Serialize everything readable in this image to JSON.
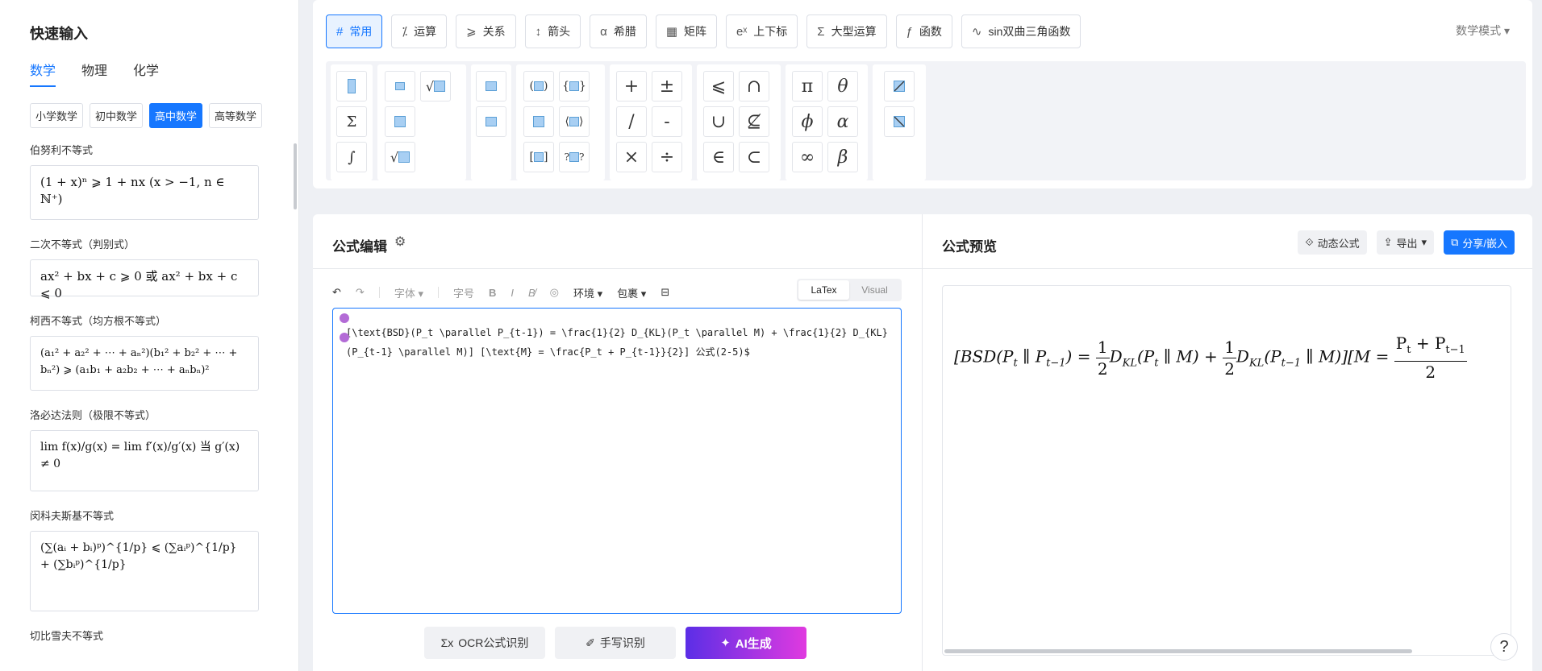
{
  "left": {
    "title": "快速输入",
    "subjects": [
      "数学",
      "物理",
      "化学"
    ],
    "levels": [
      "小学数学",
      "初中数学",
      "高中数学",
      "高等数学"
    ],
    "formulas": [
      {
        "label": "伯努利不等式",
        "body": "(1 + x)ⁿ ⩾ 1 + nx   (x > −1, n ∈ ℕ⁺)"
      },
      {
        "label": "二次不等式（判别式）",
        "body": "ax² + bx + c ⩾ 0 或 ax² + bx + c ⩽ 0"
      },
      {
        "label": "柯西不等式（均方根不等式）",
        "body": "(a₁² + a₂² + ⋯ + aₙ²)(b₁² + b₂² + ⋯ + bₙ²) ⩾ (a₁b₁ + a₂b₂ + ⋯ + aₙbₙ)²"
      },
      {
        "label": "洛必达法则（极限不等式）",
        "body": "lim f(x)/g(x) = lim f′(x)/g′(x) 当 g′(x) ≠ 0"
      },
      {
        "label": "闵科夫斯基不等式",
        "body": "(∑(aᵢ + bᵢ)ᵖ)^{1/p} ⩽ (∑aᵢᵖ)^{1/p} + (∑bᵢᵖ)^{1/p}"
      },
      {
        "label": "切比雪夫不等式",
        "body": ""
      }
    ]
  },
  "toolbar": {
    "tabs": [
      "常用",
      "运算",
      "关系",
      "箭头",
      "希腊",
      "矩阵",
      "上下标",
      "大型运算",
      "函数",
      "sin双曲三角函数"
    ],
    "mode": "数学模式",
    "symbols": {
      "ops": [
        "+",
        "±",
        "/",
        "-",
        "×",
        "÷"
      ],
      "relations": [
        "⩽",
        "∩",
        "∪",
        "⊈",
        "∈",
        "⊂"
      ],
      "greek": [
        "π",
        "θ",
        "ϕ",
        "α",
        "∞",
        "β"
      ]
    }
  },
  "editor": {
    "title": "公式编辑",
    "tools": {
      "font": "字体",
      "size": "字号",
      "env": "环境",
      "wrap": "包裹"
    },
    "modes": [
      "LaTex",
      "Visual"
    ],
    "latex": "[\\text{BSD}(P_t \\parallel P_{t-1}) = \\frac{1}{2} D_{KL}(P_t \\parallel M) + \\frac{1}{2} D_{KL}(P_{t-1} \\parallel M)] [\\text{M} = \\frac{P_t + P_{t-1}}{2}] 公式(2-5)$",
    "actions": {
      "ocr": "OCR公式识别",
      "hand": "手写识别",
      "ai": "AI生成"
    }
  },
  "preview": {
    "title": "公式预览",
    "buttons": {
      "dynamic": "动态公式",
      "export": "导出",
      "share": "分享/嵌入"
    }
  }
}
